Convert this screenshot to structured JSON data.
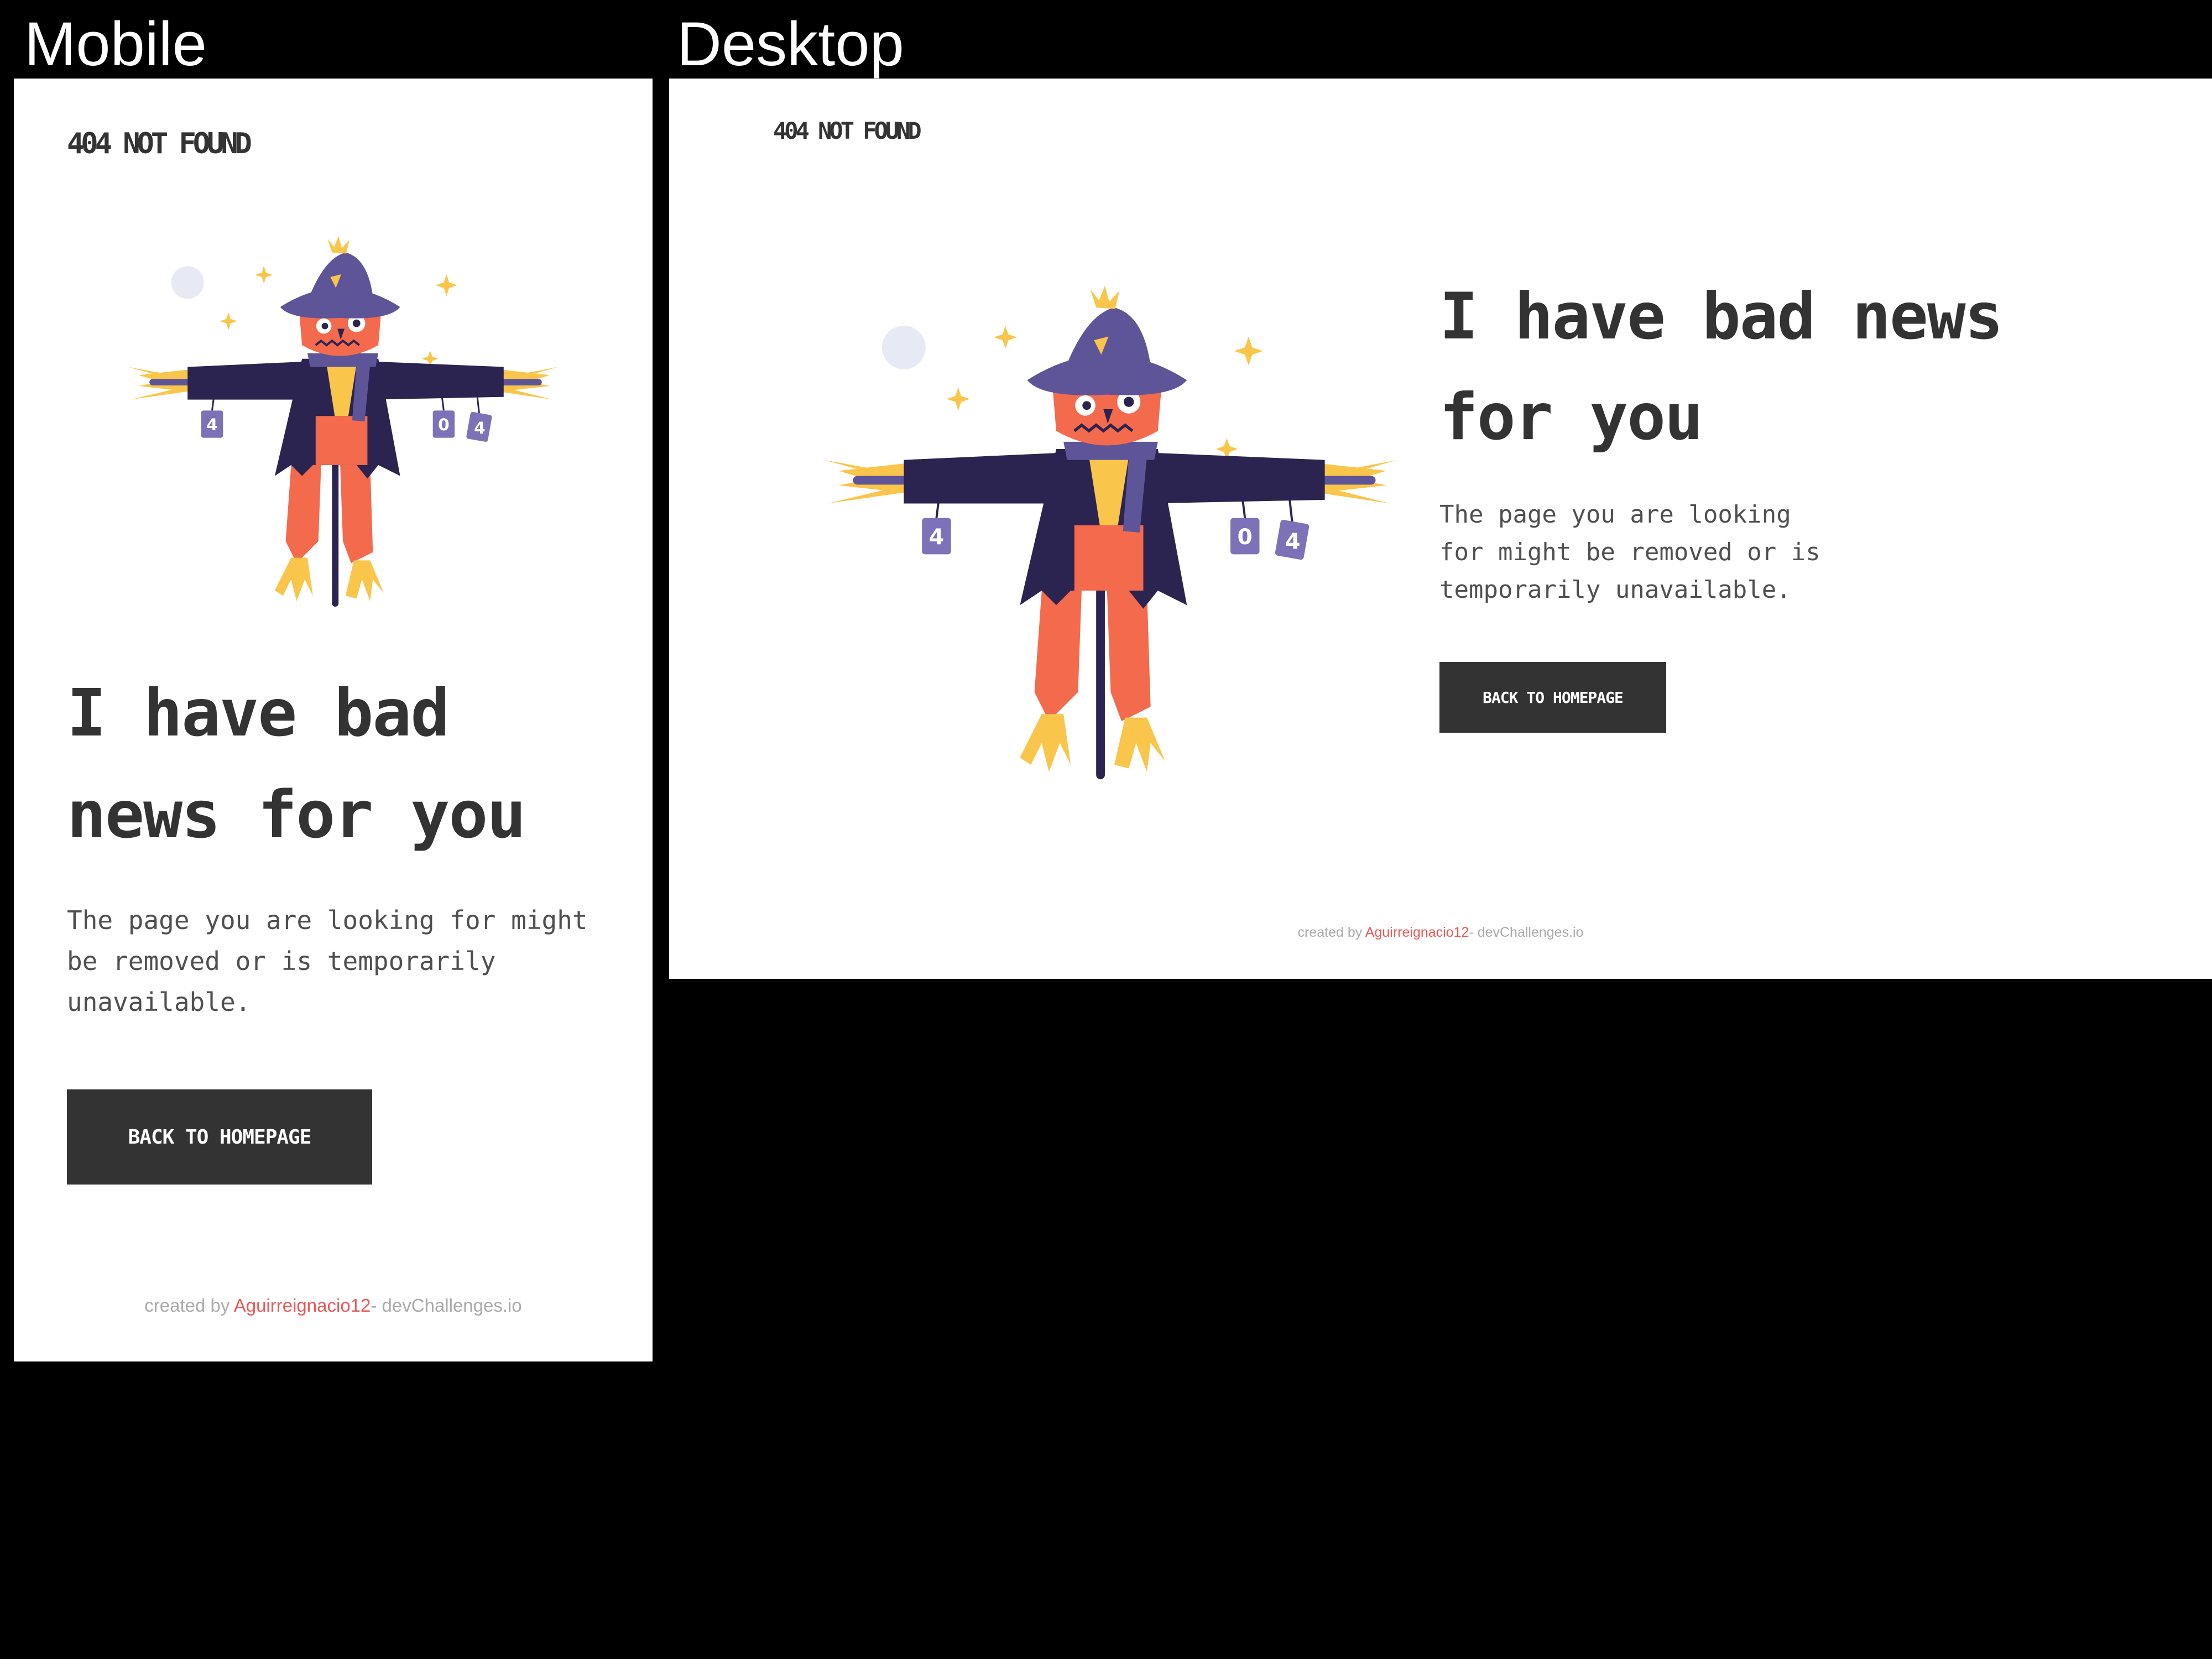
{
  "labels": {
    "mobile": "Mobile",
    "desktop": "Desktop"
  },
  "brand": "404 NOT FOUND",
  "headline": "I have bad news for you",
  "paragraph": "The page you are looking for might be removed or is temporarily unavailable.",
  "button": "BACK TO HOMEPAGE",
  "footer": {
    "prefix": "created by ",
    "author": "Aguirreignacio12",
    "suffix": "- devChallenges.io"
  },
  "illustration": {
    "name": "scarecrow-illustration",
    "cans": [
      "4",
      "0",
      "4"
    ]
  },
  "colors": {
    "background": "#ffffff",
    "text_dark": "#333333",
    "text_body": "#4f4f4f",
    "button_bg": "#333333",
    "button_text": "#ffffff",
    "footer_text": "#a9a9a9",
    "footer_author": "#eb5757",
    "scarecrow_coat": "#2b2350",
    "scarecrow_hat": "#5e5598",
    "scarecrow_face": "#f36a4d",
    "straw": "#f9c54a",
    "moon": "#e7e9f5"
  }
}
